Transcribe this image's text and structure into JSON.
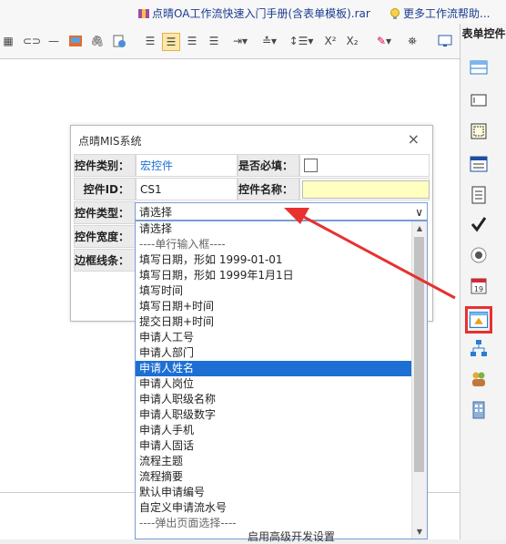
{
  "topbar": {
    "file_link": "点晴OA工作流快速入门手册(含表单模板).rar",
    "help_link": "更多工作流帮助..."
  },
  "sidebar": {
    "title": "表单控件"
  },
  "dialog": {
    "title": "点晴MIS系统",
    "close": "×",
    "rows": {
      "control_category_label": "控件类别：",
      "control_category_value": "宏控件",
      "required_label": "是否必填：",
      "control_id_label": "控件ID：",
      "control_id_value": "CS1",
      "control_name_label": "控件名称：",
      "control_type_label": "控件类型：",
      "control_width_label": "控件宽度：",
      "border_label": "边框线条："
    }
  },
  "select": {
    "value": "请选择",
    "options": [
      {
        "label": "请选择",
        "kind": "option"
      },
      {
        "label": "----单行输入框----",
        "kind": "group"
      },
      {
        "label": "填写日期，形如 1999-01-01",
        "kind": "option"
      },
      {
        "label": "填写日期，形如 1999年1月1日",
        "kind": "option"
      },
      {
        "label": "填写时间",
        "kind": "option"
      },
      {
        "label": "填写日期+时间",
        "kind": "option"
      },
      {
        "label": "提交日期+时间",
        "kind": "option"
      },
      {
        "label": "申请人工号",
        "kind": "option"
      },
      {
        "label": "申请人部门",
        "kind": "option"
      },
      {
        "label": "申请人姓名",
        "kind": "selected"
      },
      {
        "label": "申请人岗位",
        "kind": "option"
      },
      {
        "label": "申请人职级名称",
        "kind": "option"
      },
      {
        "label": "申请人职级数字",
        "kind": "option"
      },
      {
        "label": "申请人手机",
        "kind": "option"
      },
      {
        "label": "申请人固话",
        "kind": "option"
      },
      {
        "label": "流程主题",
        "kind": "option"
      },
      {
        "label": "流程摘要",
        "kind": "option"
      },
      {
        "label": "默认申请编号",
        "kind": "option"
      },
      {
        "label": "自定义申请流水号",
        "kind": "option"
      },
      {
        "label": "----弹出页面选择----",
        "kind": "group"
      }
    ]
  },
  "bottom_text": "启用高级开发设置",
  "colors": {
    "selected_bg": "#1e6fd3",
    "highlight_red": "#e8312f",
    "input_yellow": "#ffffc0"
  }
}
